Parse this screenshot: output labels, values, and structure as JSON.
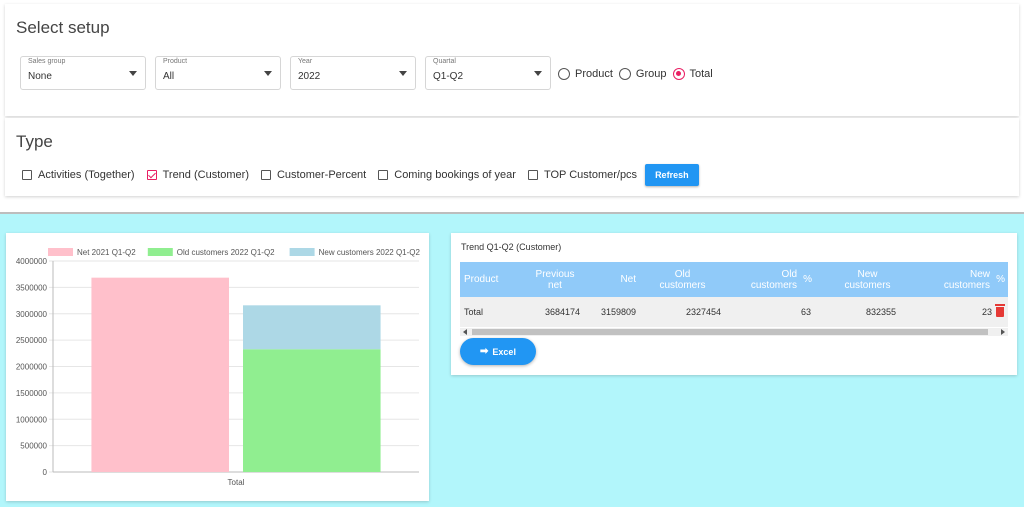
{
  "setup": {
    "title": "Select setup",
    "selects": [
      {
        "label": "Sales group",
        "value": "None"
      },
      {
        "label": "Product",
        "value": "All"
      },
      {
        "label": "Year",
        "value": "2022"
      },
      {
        "label": "Quartal",
        "value": "Q1-Q2"
      }
    ],
    "radios": [
      {
        "label": "Product",
        "checked": false
      },
      {
        "label": "Group",
        "checked": false
      },
      {
        "label": "Total",
        "checked": true
      }
    ]
  },
  "type": {
    "title": "Type",
    "checks": [
      {
        "label": "Activities (Together)",
        "checked": false
      },
      {
        "label": "Trend (Customer)",
        "checked": true
      },
      {
        "label": "Customer-Percent",
        "checked": false
      },
      {
        "label": "Coming bookings of year",
        "checked": false
      },
      {
        "label": "TOP Customer/pcs",
        "checked": false
      }
    ],
    "refresh_label": "Refresh"
  },
  "chart_data": {
    "type": "bar",
    "categories": [
      "Total"
    ],
    "series": [
      {
        "name": "Net 2021 Q1-Q2",
        "values": [
          3684174
        ],
        "color": "#ffc0cb",
        "stack": "a"
      },
      {
        "name": "Old customers 2022 Q1-Q2",
        "values": [
          2327454
        ],
        "color": "#90ee90",
        "stack": "b"
      },
      {
        "name": "New customers 2022 Q1-Q2",
        "values": [
          832355
        ],
        "color": "#add8e6",
        "stack": "b"
      }
    ],
    "ylim": [
      0,
      4000000
    ],
    "yticks": [
      "0",
      "500000",
      "1000000",
      "1500000",
      "2000000",
      "2500000",
      "3000000",
      "3500000",
      "4000000"
    ],
    "legend": "top",
    "grid": true
  },
  "table": {
    "title": "Trend Q1-Q2 (Customer)",
    "headers": {
      "product": "Product",
      "prev_net_1": "Previous",
      "prev_net_2": "net",
      "net": "Net",
      "old1_1": "Old",
      "old1_2": "customers",
      "old2_1": "Old",
      "old2_2": "customers",
      "old_pct": "%",
      "new1_1": "New",
      "new1_2": "customers",
      "new2_1": "New",
      "new2_2": "customers",
      "new_pct": "%"
    },
    "row": {
      "product": "Total",
      "prev_net": "3684174",
      "net": "3159809",
      "old_customers": "2327454",
      "old_pct": "63",
      "new_customers": "832355",
      "new_pct": "23"
    },
    "excel_label": "Excel"
  },
  "icons": {
    "excel": "arrow-right-icon",
    "delete": "trash-icon"
  }
}
